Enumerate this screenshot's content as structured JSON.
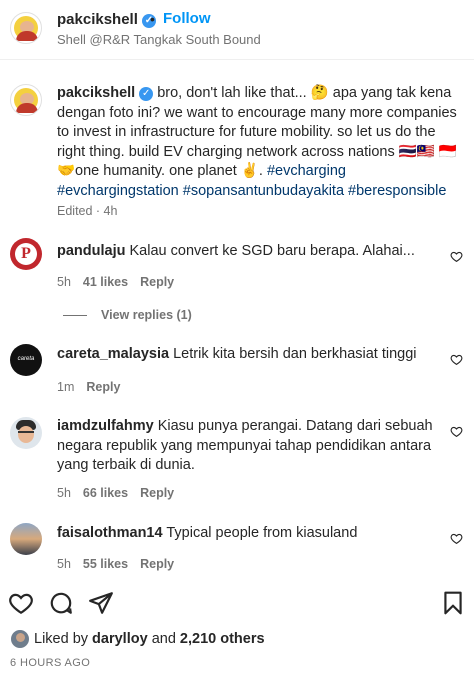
{
  "header": {
    "username": "pakcikshell",
    "separator": "•",
    "follow_label": "Follow",
    "subtitle": "Shell @R&R Tangkak South Bound"
  },
  "caption": {
    "username": "pakcikshell",
    "text_1": "bro, don't lah like that... 🤔 apa yang tak kena dengan foto ini? we want to encourage many more companies to invest in infrastructure for future mobility. so let us do the right thing. build EV charging network across nations 🇹🇭🇲🇾 🇮🇩 🤝one humanity. one planet ✌️.",
    "hashtag_1": "#evcharging",
    "hashtag_2": "#evchargingstation",
    "hashtag_3": "#sopansantunbudayakita",
    "hashtag_4": "#beresponsible",
    "meta": "Edited · 4h"
  },
  "comments": [
    {
      "username": "pandulaju",
      "text": "Kalau convert ke SGD baru berapa. Alahai...",
      "time": "5h",
      "likes": "41 likes",
      "reply": "Reply",
      "view_replies": "View replies (1)"
    },
    {
      "username": "careta_malaysia",
      "text": "Letrik kita bersih dan berkhasiat tinggi",
      "time": "1m",
      "reply": "Reply",
      "avatar_text": "careta"
    },
    {
      "username": "iamdzulfahmy",
      "text": "Kiasu punya perangai. Datang dari sebuah negara republik yang mempunyai tahap pendidikan antara yang terbaik di dunia.",
      "time": "5h",
      "likes": "66 likes",
      "reply": "Reply"
    },
    {
      "username": "faisalothman14",
      "text": "Typical people from kiasuland",
      "time": "5h",
      "likes": "55 likes",
      "reply": "Reply"
    }
  ],
  "liked_by": {
    "prefix": "Liked by",
    "user": "darylloy",
    "middle": "and",
    "others": "2,210 others"
  },
  "time_ago": "6 HOURS AGO",
  "icons": {
    "verified": "verified-badge-icon",
    "like": "heart-icon",
    "comment": "comment-bubble-icon",
    "share": "paper-plane-icon",
    "save": "bookmark-icon"
  },
  "colors": {
    "link_blue": "#0095f6",
    "hashtag": "#00376b",
    "verified": "#3897f0",
    "muted": "#737373"
  }
}
